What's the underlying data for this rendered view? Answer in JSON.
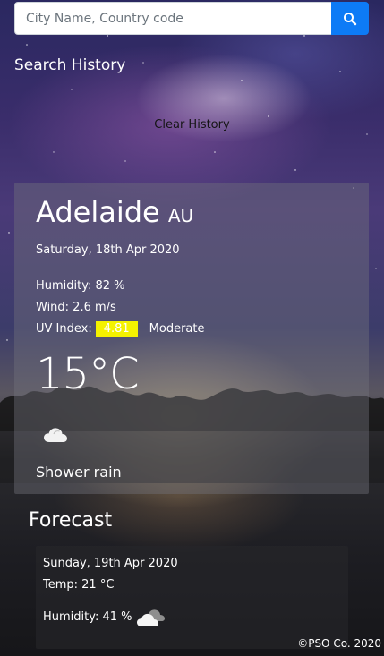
{
  "search": {
    "placeholder": "City Name, Country code",
    "button_icon": "search-icon",
    "button_color": "#0d7bf6"
  },
  "history": {
    "title": "Search History",
    "clear_label": "Clear History"
  },
  "current": {
    "city": "Adelaide",
    "country": "AU",
    "date": "Saturday, 18th Apr 2020",
    "humidity": "Humidity: 82 %",
    "wind": "Wind: 2.6 m/s",
    "uv_label": "UV Index:",
    "uv_value": "4.81",
    "uv_level": "Moderate",
    "uv_color": "#f5f200",
    "temperature": "15°C",
    "icon": "cloud-icon",
    "description": "Shower rain"
  },
  "forecast": {
    "title": "Forecast",
    "days": [
      {
        "date": "Sunday, 19th Apr 2020",
        "temp": "Temp: 21 °C",
        "humidity": "Humidity: 41 %",
        "icon": "cloud-icon"
      }
    ]
  },
  "footer": {
    "text": "©PSO Co. 2020"
  }
}
